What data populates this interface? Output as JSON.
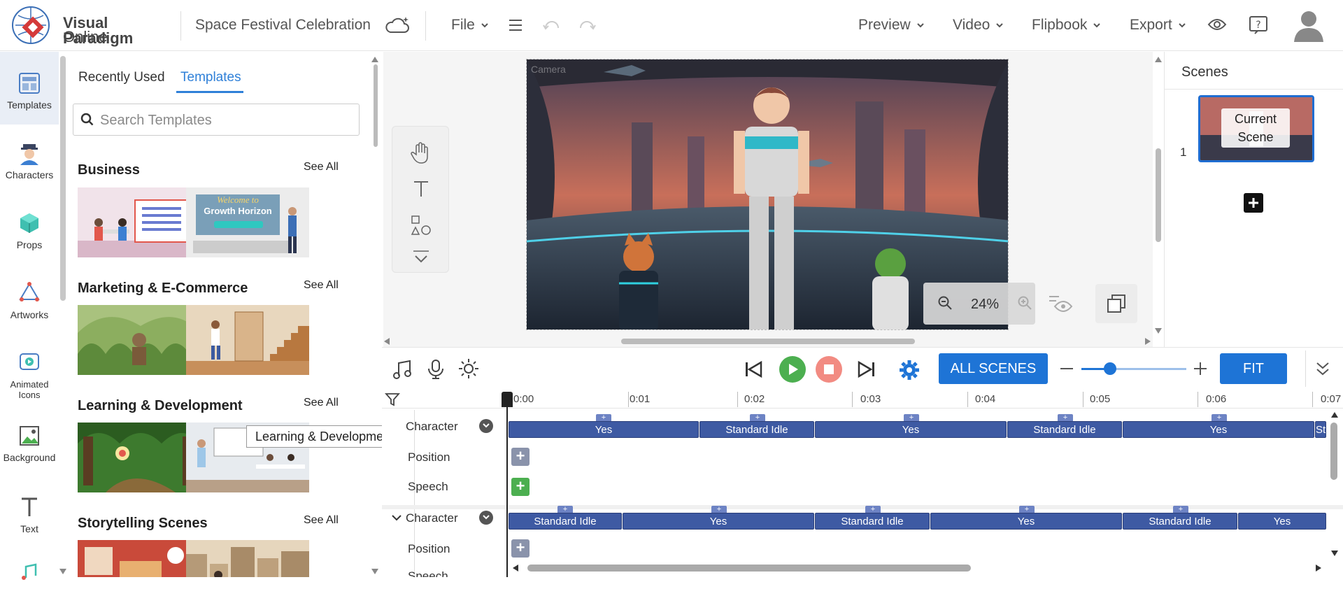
{
  "app": {
    "logo_line1": "Visual Paradigm",
    "logo_line2": "Online",
    "project_title": "Space Festival Celebration",
    "menu_file": "File",
    "menu_preview": "Preview",
    "menu_video": "Video",
    "menu_flipbook": "Flipbook",
    "menu_export": "Export"
  },
  "sidebar": {
    "items": [
      {
        "label": "Templates",
        "icon": "templates-icon"
      },
      {
        "label": "Characters",
        "icon": "characters-icon"
      },
      {
        "label": "Props",
        "icon": "props-icon"
      },
      {
        "label": "Artworks",
        "icon": "artworks-icon"
      },
      {
        "label": "Animated",
        "label2": "Icons",
        "icon": "animated-icons-icon"
      },
      {
        "label": "Background",
        "icon": "background-icon"
      },
      {
        "label": "Text",
        "icon": "text-icon"
      }
    ]
  },
  "panel": {
    "tabs": [
      "Recently Used",
      "Templates"
    ],
    "search_placeholder": "Search Templates",
    "categories": [
      {
        "title": "Business",
        "see_all": "See All",
        "thumb2_text1": "Welcome to",
        "thumb2_text2": "Growth Horizon"
      },
      {
        "title": "Marketing & E-Commerce",
        "see_all": "See All"
      },
      {
        "title": "Learning & Development",
        "see_all": "See All"
      },
      {
        "title": "Storytelling Scenes",
        "see_all": "See All"
      }
    ],
    "tooltip": "Learning & Development"
  },
  "stage": {
    "camera_label": "Camera",
    "zoom": "24%"
  },
  "scenes": {
    "title": "Scenes",
    "items": [
      {
        "num": "1",
        "label1": "Current",
        "label2": "Scene"
      }
    ]
  },
  "controls": {
    "all_scenes": "ALL SCENES",
    "fit": "FIT",
    "zoom_fraction": 0.27
  },
  "timeline": {
    "ruler": [
      "0:00",
      "0:01",
      "0:02",
      "0:03",
      "0:04",
      "0:05",
      "0:06",
      "0:07"
    ],
    "tracks": {
      "character": "Character",
      "position": "Position",
      "speech": "Speech"
    },
    "row1_segments": [
      "Yes",
      "Standard Idle",
      "Yes",
      "Standard Idle",
      "Yes",
      "St"
    ],
    "row2_segments": [
      "Standard Idle",
      "Yes",
      "Standard Idle",
      "Yes",
      "Standard Idle",
      "Yes"
    ]
  },
  "colors": {
    "accent": "#1e74d6",
    "segment": "#3e5aa3",
    "play": "#4caf50",
    "stop": "#f28b82"
  }
}
